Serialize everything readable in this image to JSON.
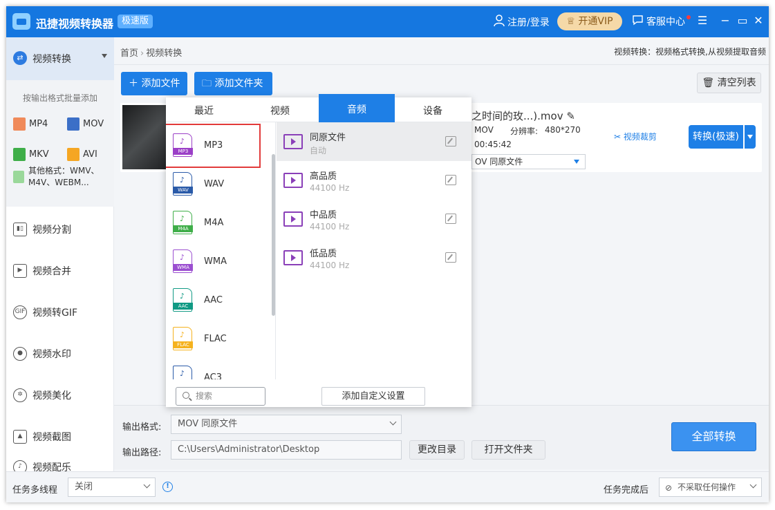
{
  "app": {
    "title": "迅捷视频转换器",
    "edition": "极速版",
    "login": "注册/登录",
    "vip": "开通VIP",
    "service": "客服中心"
  },
  "sidebar": {
    "active": "视频转换",
    "hint": "按输出格式批量添加",
    "formats": [
      "MP4",
      "MOV",
      "MKV",
      "AVI"
    ],
    "other_formats": "其他格式：WMV、M4V、WEBM...",
    "items": [
      "视频分割",
      "视频合并",
      "视频转GIF",
      "视频水印",
      "视频美化",
      "视频截图",
      "视频配乐"
    ]
  },
  "main": {
    "breadcrumb_home": "首页",
    "breadcrumb_current": "视频转换",
    "description": "视频转换：视频格式转换,从视频提取音频",
    "add_file": "添加文件",
    "add_folder": "添加文件夹",
    "clear_list": "清空列表"
  },
  "file": {
    "name": "之时间的玫...).mov",
    "format": "MOV",
    "resolution_label": "分辨率:",
    "resolution": "480*270",
    "duration": "00:45:42",
    "output_select": "OV  同原文件",
    "crop": "视频裁剪",
    "convert": "转换(极速)"
  },
  "popup": {
    "tabs": [
      "最近",
      "视频",
      "音频",
      "设备"
    ],
    "active_tab": "音频",
    "formats": [
      {
        "name": "MP3",
        "color": "#9b3fc7"
      },
      {
        "name": "WAV",
        "color": "#2a5aa8"
      },
      {
        "name": "M4A",
        "color": "#3fae49"
      },
      {
        "name": "WMA",
        "color": "#9b4fd0"
      },
      {
        "name": "AAC",
        "color": "#109a84"
      },
      {
        "name": "FLAC",
        "color": "#f5b21e"
      },
      {
        "name": "AC3",
        "color": "#2a5aa8"
      }
    ],
    "qualities": [
      {
        "name": "同原文件",
        "sub": "自动"
      },
      {
        "name": "高品质",
        "sub": "44100 Hz"
      },
      {
        "name": "中品质",
        "sub": "44100 Hz"
      },
      {
        "name": "低品质",
        "sub": "44100 Hz"
      }
    ],
    "search_placeholder": "搜索",
    "custom": "添加自定义设置"
  },
  "bottom": {
    "output_format_label": "输出格式:",
    "output_format": "MOV  同原文件",
    "output_path_label": "输出路径:",
    "output_path": "C:\\Users\\Administrator\\Desktop",
    "change_dir": "更改目录",
    "open_folder": "打开文件夹",
    "convert_all": "全部转换"
  },
  "status": {
    "multithread_label": "任务多线程",
    "multithread_value": "关闭",
    "after_label": "任务完成后",
    "after_value": "不采取任何操作"
  },
  "colors": {
    "accent": "#1e7fe6",
    "titlebar": "#1577e0",
    "highlight": "#e23a3a"
  }
}
